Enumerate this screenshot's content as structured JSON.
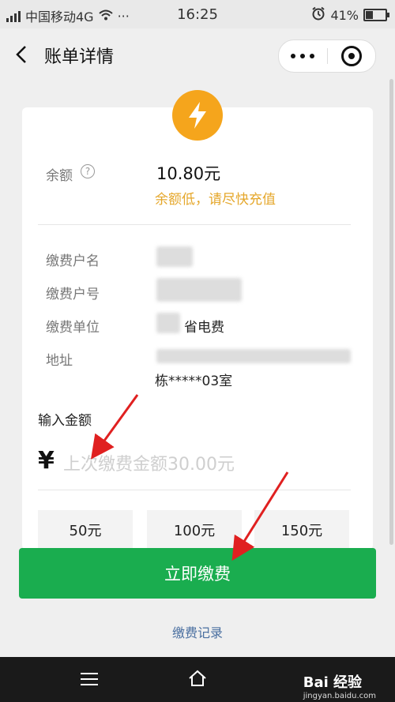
{
  "status_bar": {
    "carrier": "中国移动4G",
    "time": "16:25",
    "battery": "41%",
    "battery_level": 0.41,
    "more_label": "···"
  },
  "nav": {
    "title": "账单详情",
    "back_icon": "chevron-left-icon",
    "more_icon": "more-dots-icon",
    "close_icon": "target-close-icon"
  },
  "summary": {
    "balance_label": "余额",
    "balance_value": "10.80元",
    "low_balance_tip": "余额低，请尽快充值",
    "tip_color": "#e5a72b",
    "icon": "lightning-icon",
    "icon_color": "#f5a51c",
    "help_icon": "?"
  },
  "account": {
    "name_label": "缴费户名",
    "number_label": "缴费户号",
    "unit_label": "缴费单位",
    "unit_value": "省电费",
    "address_label": "地址",
    "address_value": "栋*****03室"
  },
  "input": {
    "label": "输入金额",
    "currency": "¥",
    "placeholder": "上次缴费金额30.00元"
  },
  "quick_amounts": [
    "50元",
    "100元",
    "150元"
  ],
  "actions": {
    "pay_label": "立即缴费",
    "pay_color": "#1aad4f",
    "record_label": "缴费记录"
  },
  "watermark": {
    "brand": "Bai 经验",
    "url": "jingyan.baidu.com"
  }
}
